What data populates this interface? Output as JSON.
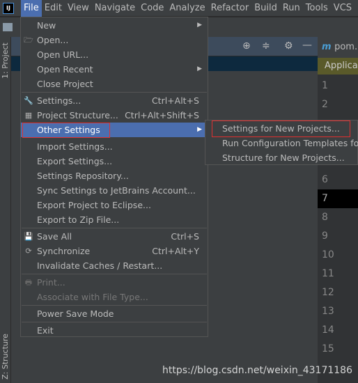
{
  "menubar": {
    "items": [
      "File",
      "Edit",
      "View",
      "Navigate",
      "Code",
      "Analyze",
      "Refactor",
      "Build",
      "Run",
      "Tools",
      "VCS"
    ],
    "active": "File"
  },
  "side": {
    "project": "1: Project",
    "structure": "Z: Structure"
  },
  "editor": {
    "tab": "pom.",
    "banner": "Applicati",
    "line_numbers": [
      "1",
      "2",
      "6",
      "7",
      "8",
      "9",
      "10",
      "11",
      "12",
      "13",
      "14",
      "15"
    ],
    "current_line": "7"
  },
  "file_menu": {
    "new": "New",
    "open": "Open...",
    "open_url": "Open URL...",
    "open_recent": "Open Recent",
    "close_project": "Close Project",
    "settings": "Settings...",
    "settings_sc": "Ctrl+Alt+S",
    "project_structure": "Project Structure...",
    "project_structure_sc": "Ctrl+Alt+Shift+S",
    "other_settings": "Other Settings",
    "import_settings": "Import Settings...",
    "export_settings": "Export Settings...",
    "settings_repo": "Settings Repository...",
    "sync_jb": "Sync Settings to JetBrains Account...",
    "export_eclipse": "Export Project to Eclipse...",
    "export_zip": "Export to Zip File...",
    "save_all": "Save All",
    "save_all_sc": "Ctrl+S",
    "synchronize": "Synchronize",
    "synchronize_sc": "Ctrl+Alt+Y",
    "invalidate": "Invalidate Caches / Restart...",
    "print": "Print...",
    "associate": "Associate with File Type...",
    "power_save": "Power Save Mode",
    "exit": "Exit"
  },
  "submenu": {
    "items": [
      "Settings for New Projects...",
      "Run Configuration Templates for",
      "Structure for New Projects..."
    ]
  },
  "watermark": "https://blog.csdn.net/weixin_43171186",
  "colors": {
    "highlight": "#4b6eaf",
    "annotation": "#e03030",
    "menu_bg": "#3c3f41"
  }
}
